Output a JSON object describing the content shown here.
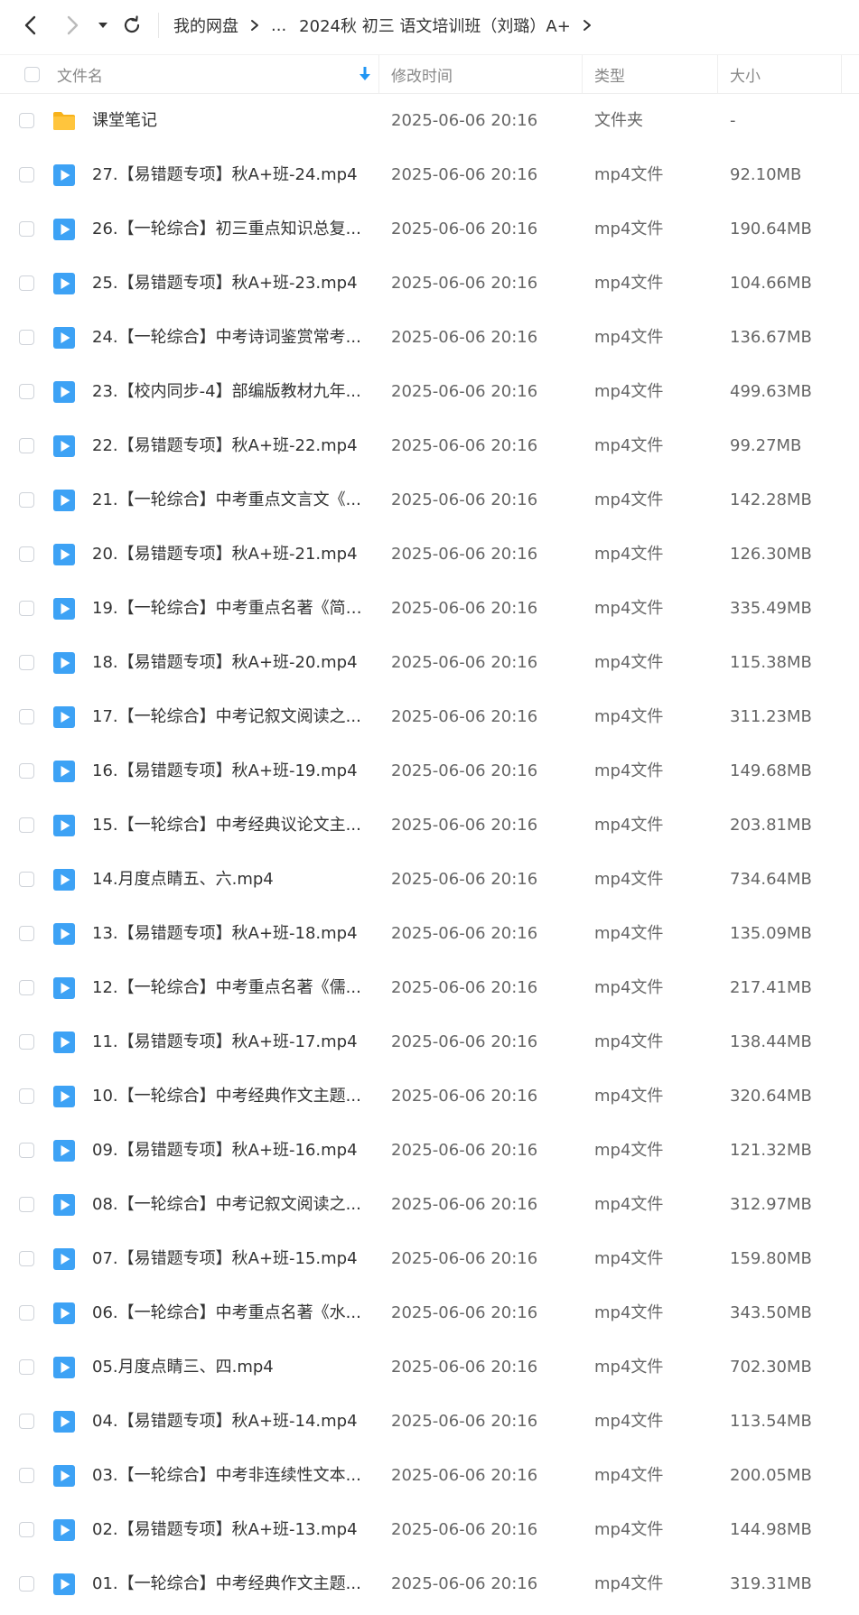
{
  "breadcrumb": {
    "root": "我的网盘",
    "ellipsis": "...",
    "current": "2024秋 初三 语文培训班（刘璐）A+"
  },
  "columns": {
    "name": "文件名",
    "modified": "修改时间",
    "type": "类型",
    "size": "大小"
  },
  "colors": {
    "folder": "#FFC53D",
    "video": "#3DA2F5",
    "header_text": "#888888",
    "sort_arrow": "#2196F3"
  },
  "files": [
    {
      "name": "课堂笔记",
      "modified": "2025-06-06 20:16",
      "type": "文件夹",
      "size": "-",
      "icon": "folder-icon"
    },
    {
      "name": "27.【易错题专项】秋A+班-24.mp4",
      "modified": "2025-06-06 20:16",
      "type": "mp4文件",
      "size": "92.10MB",
      "icon": "video-file-icon"
    },
    {
      "name": "26.【一轮综合】初三重点知识总复...",
      "modified": "2025-06-06 20:16",
      "type": "mp4文件",
      "size": "190.64MB",
      "icon": "video-file-icon"
    },
    {
      "name": "25.【易错题专项】秋A+班-23.mp4",
      "modified": "2025-06-06 20:16",
      "type": "mp4文件",
      "size": "104.66MB",
      "icon": "video-file-icon"
    },
    {
      "name": "24.【一轮综合】中考诗词鉴赏常考...",
      "modified": "2025-06-06 20:16",
      "type": "mp4文件",
      "size": "136.67MB",
      "icon": "video-file-icon"
    },
    {
      "name": "23.【校内同步-4】部编版教材九年...",
      "modified": "2025-06-06 20:16",
      "type": "mp4文件",
      "size": "499.63MB",
      "icon": "video-file-icon"
    },
    {
      "name": "22.【易错题专项】秋A+班-22.mp4",
      "modified": "2025-06-06 20:16",
      "type": "mp4文件",
      "size": "99.27MB",
      "icon": "video-file-icon"
    },
    {
      "name": "21.【一轮综合】中考重点文言文《...",
      "modified": "2025-06-06 20:16",
      "type": "mp4文件",
      "size": "142.28MB",
      "icon": "video-file-icon"
    },
    {
      "name": "20.【易错题专项】秋A+班-21.mp4",
      "modified": "2025-06-06 20:16",
      "type": "mp4文件",
      "size": "126.30MB",
      "icon": "video-file-icon"
    },
    {
      "name": "19.【一轮综合】中考重点名著《简·...",
      "modified": "2025-06-06 20:16",
      "type": "mp4文件",
      "size": "335.49MB",
      "icon": "video-file-icon"
    },
    {
      "name": "18.【易错题专项】秋A+班-20.mp4",
      "modified": "2025-06-06 20:16",
      "type": "mp4文件",
      "size": "115.38MB",
      "icon": "video-file-icon"
    },
    {
      "name": "17.【一轮综合】中考记叙文阅读之...",
      "modified": "2025-06-06 20:16",
      "type": "mp4文件",
      "size": "311.23MB",
      "icon": "video-file-icon"
    },
    {
      "name": "16.【易错题专项】秋A+班-19.mp4",
      "modified": "2025-06-06 20:16",
      "type": "mp4文件",
      "size": "149.68MB",
      "icon": "video-file-icon"
    },
    {
      "name": "15.【一轮综合】中考经典议论文主...",
      "modified": "2025-06-06 20:16",
      "type": "mp4文件",
      "size": "203.81MB",
      "icon": "video-file-icon"
    },
    {
      "name": "14.月度点睛五、六.mp4",
      "modified": "2025-06-06 20:16",
      "type": "mp4文件",
      "size": "734.64MB",
      "icon": "video-file-icon"
    },
    {
      "name": "13.【易错题专项】秋A+班-18.mp4",
      "modified": "2025-06-06 20:16",
      "type": "mp4文件",
      "size": "135.09MB",
      "icon": "video-file-icon"
    },
    {
      "name": "12.【一轮综合】中考重点名著《儒...",
      "modified": "2025-06-06 20:16",
      "type": "mp4文件",
      "size": "217.41MB",
      "icon": "video-file-icon"
    },
    {
      "name": "11.【易错题专项】秋A+班-17.mp4",
      "modified": "2025-06-06 20:16",
      "type": "mp4文件",
      "size": "138.44MB",
      "icon": "video-file-icon"
    },
    {
      "name": "10.【一轮综合】中考经典作文主题...",
      "modified": "2025-06-06 20:16",
      "type": "mp4文件",
      "size": "320.64MB",
      "icon": "video-file-icon"
    },
    {
      "name": "09.【易错题专项】秋A+班-16.mp4",
      "modified": "2025-06-06 20:16",
      "type": "mp4文件",
      "size": "121.32MB",
      "icon": "video-file-icon"
    },
    {
      "name": "08.【一轮综合】中考记叙文阅读之...",
      "modified": "2025-06-06 20:16",
      "type": "mp4文件",
      "size": "312.97MB",
      "icon": "video-file-icon"
    },
    {
      "name": "07.【易错题专项】秋A+班-15.mp4",
      "modified": "2025-06-06 20:16",
      "type": "mp4文件",
      "size": "159.80MB",
      "icon": "video-file-icon"
    },
    {
      "name": "06.【一轮综合】中考重点名著《水...",
      "modified": "2025-06-06 20:16",
      "type": "mp4文件",
      "size": "343.50MB",
      "icon": "video-file-icon"
    },
    {
      "name": "05.月度点睛三、四.mp4",
      "modified": "2025-06-06 20:16",
      "type": "mp4文件",
      "size": "702.30MB",
      "icon": "video-file-icon"
    },
    {
      "name": "04.【易错题专项】秋A+班-14.mp4",
      "modified": "2025-06-06 20:16",
      "type": "mp4文件",
      "size": "113.54MB",
      "icon": "video-file-icon"
    },
    {
      "name": "03.【一轮综合】中考非连续性文本...",
      "modified": "2025-06-06 20:16",
      "type": "mp4文件",
      "size": "200.05MB",
      "icon": "video-file-icon"
    },
    {
      "name": "02.【易错题专项】秋A+班-13.mp4",
      "modified": "2025-06-06 20:16",
      "type": "mp4文件",
      "size": "144.98MB",
      "icon": "video-file-icon"
    },
    {
      "name": "01.【一轮综合】中考经典作文主题...",
      "modified": "2025-06-06 20:16",
      "type": "mp4文件",
      "size": "319.31MB",
      "icon": "video-file-icon"
    }
  ]
}
